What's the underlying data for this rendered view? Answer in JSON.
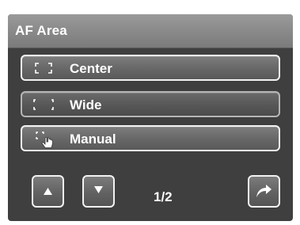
{
  "menu": {
    "title": "AF Area"
  },
  "options": [
    {
      "label": "Center",
      "icon": "af-center-icon"
    },
    {
      "label": "Wide",
      "icon": "af-wide-icon"
    },
    {
      "label": "Manual",
      "icon": "af-manual-icon"
    }
  ],
  "selected_option": "Wide",
  "pagination": {
    "indicator": "1/2",
    "up_icon": "triangle-up-icon",
    "down_icon": "triangle-down-icon"
  },
  "actions": {
    "back_icon": "return-arrow-icon"
  },
  "colors": {
    "panel_background": "#3f3f3f",
    "title_bar": "#8a8a8a",
    "button_border": "#f2f2f2",
    "text": "#ffffff"
  }
}
